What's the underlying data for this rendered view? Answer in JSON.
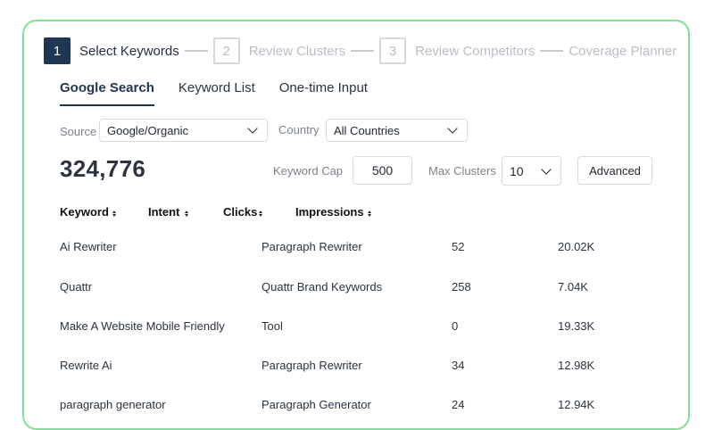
{
  "stepper": [
    {
      "num": "1",
      "label": "Select Keywords"
    },
    {
      "num": "2",
      "label": "Review Clusters"
    },
    {
      "num": "3",
      "label": "Review Competitors"
    },
    {
      "label": "Coverage Planner"
    }
  ],
  "tabs": [
    {
      "label": "Google Search"
    },
    {
      "label": "Keyword List"
    },
    {
      "label": "One-time Input"
    }
  ],
  "filters": {
    "source_label": "Source",
    "source_value": "Google/Organic",
    "country_label": "Country",
    "country_value": "All Countries"
  },
  "total_keywords": "324,776",
  "controls": {
    "keyword_cap_label": "Keyword Cap",
    "keyword_cap_value": "500",
    "max_clusters_label": "Max Clusters",
    "max_clusters_value": "10",
    "advanced_label": "Advanced"
  },
  "table": {
    "headers": [
      "Keyword",
      "Intent",
      "Clicks",
      "Impressions"
    ],
    "rows": [
      {
        "keyword": "Ai Rewriter",
        "intent": "Paragraph Rewriter",
        "clicks": "52",
        "impressions": "20.02K"
      },
      {
        "keyword": "Quattr",
        "intent": "Quattr Brand Keywords",
        "clicks": "258",
        "impressions": "7.04K"
      },
      {
        "keyword": "Make A Website Mobile Friendly",
        "intent": "Tool",
        "clicks": "0",
        "impressions": "19.33K"
      },
      {
        "keyword": "Rewrite Ai",
        "intent": "Paragraph Rewriter",
        "clicks": "34",
        "impressions": "12.98K"
      },
      {
        "keyword": "paragraph generator",
        "intent": "Paragraph Generator",
        "clicks": "24",
        "impressions": "12.94K"
      }
    ]
  },
  "colors": {
    "accent": "#1f3654",
    "card_border": "#86dd9b"
  }
}
